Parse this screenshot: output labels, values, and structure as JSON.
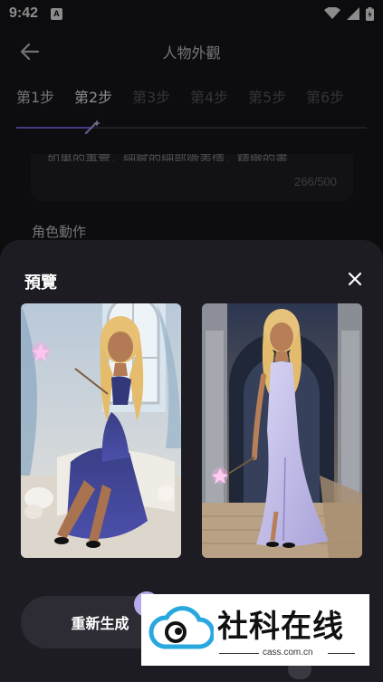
{
  "status_bar": {
    "time": "9:42",
    "notification_badge": "A"
  },
  "header": {
    "title": "人物外觀",
    "back_icon": "arrow-left-icon"
  },
  "steps": [
    {
      "label": "第1步",
      "state": "done"
    },
    {
      "label": "第2步",
      "state": "active"
    },
    {
      "label": "第3步",
      "state": "todo"
    },
    {
      "label": "第4步",
      "state": "todo"
    },
    {
      "label": "第5步",
      "state": "todo"
    },
    {
      "label": "第6步",
      "state": "todo"
    }
  ],
  "description": {
    "clipped_text": "如果的事實，細膩的細部微表情，精緻的畫",
    "char_count": "266/500"
  },
  "action_section": {
    "label": "角色動作"
  },
  "preview_sheet": {
    "title": "預覽",
    "close_icon": "close-icon",
    "images": [
      {
        "desc": "blonde woman in navy dress holding sparkling wand, sitting on bed with roses"
      },
      {
        "desc": "blonde woman in lilac satin gown holding wand, standing in stone castle hall"
      }
    ],
    "regenerate_label": "重新生成"
  },
  "watermark": {
    "brand": "社科在线",
    "url": "cass.com.cn"
  },
  "colors": {
    "accent": "#7b6cf0",
    "sheet_bg": "#1d1c23",
    "button_bg": "#2d2c34"
  }
}
